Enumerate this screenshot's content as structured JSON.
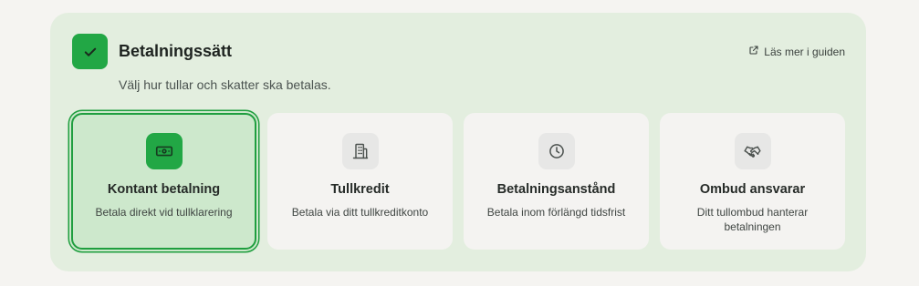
{
  "section": {
    "title": "Betalningssätt",
    "subtitle": "Välj hur tullar och skatter ska betalas.",
    "guide_link": "Läs mer i guiden",
    "check_icon": "check-icon"
  },
  "colors": {
    "accent": "#22a745",
    "panel_bg": "#e3eedf",
    "selected_card_bg": "#cde8cc"
  },
  "options": [
    {
      "title": "Kontant betalning",
      "description": "Betala direkt vid tullklarering",
      "icon": "cash-icon",
      "selected": true
    },
    {
      "title": "Tullkredit",
      "description": "Betala via ditt tullkreditkonto",
      "icon": "building-icon",
      "selected": false
    },
    {
      "title": "Betalningsanstånd",
      "description": "Betala inom förlängd tidsfrist",
      "icon": "clock-icon",
      "selected": false
    },
    {
      "title": "Ombud ansvarar",
      "description": "Ditt tullombud hanterar betalningen",
      "icon": "handshake-icon",
      "selected": false
    }
  ]
}
